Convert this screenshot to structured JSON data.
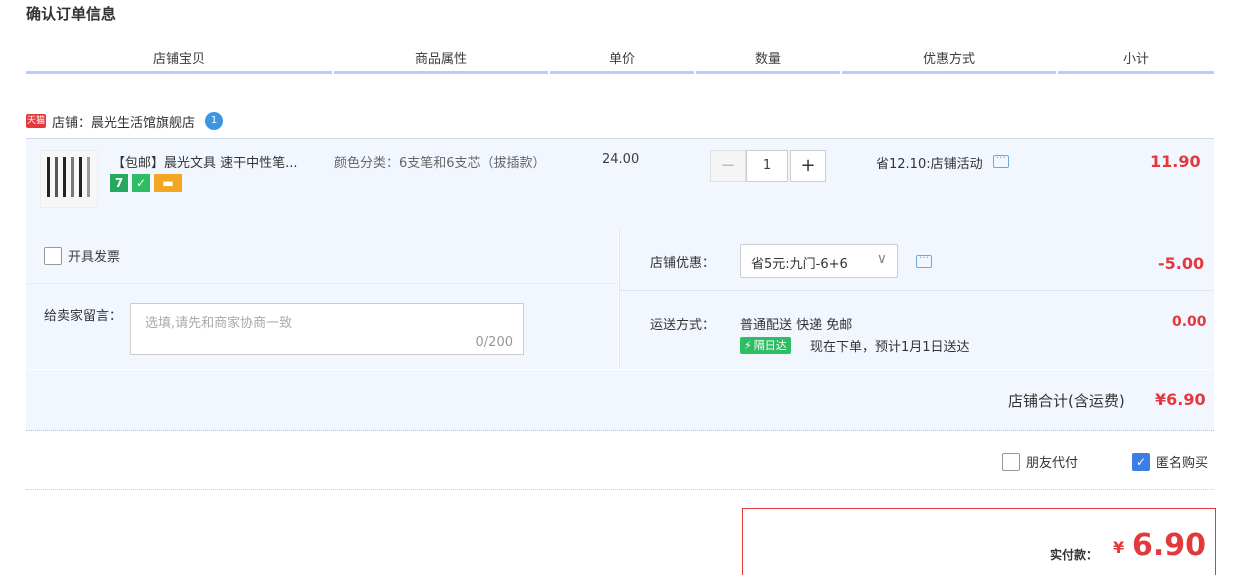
{
  "page_title": "确认订单信息",
  "columns": [
    "店铺宝贝",
    "商品属性",
    "单价",
    "数量",
    "优惠方式",
    "小计"
  ],
  "shop": {
    "badge": "天猫",
    "label": "店铺：晨光生活馆旗舰店",
    "ww_icon": "1"
  },
  "item": {
    "name": "【包邮】晨光文具 速干中性笔...",
    "badges": [
      "7",
      "✓",
      "▬"
    ],
    "attribute": "颜色分类：6支笔和6支芯（拔插款）",
    "unit_price": "24.00",
    "qty_minus": "−",
    "quantity": "1",
    "qty_plus": "+",
    "promo": "省12.10:店铺活动",
    "subtotal": "11.90"
  },
  "invoice": {
    "label": "开具发票"
  },
  "message": {
    "label": "给卖家留言：",
    "placeholder": "选填,请先和商家协商一致",
    "counter": "0/200"
  },
  "store_promo": {
    "label": "店铺优惠：",
    "selected": "省5元:九门-6+6",
    "amount": "-5.00"
  },
  "shipping": {
    "label": "运送方式：",
    "value": "普通配送 快递 免邮",
    "badge": "隔日达",
    "eta": "现在下单，预计1月1日送达",
    "amount": "0.00"
  },
  "store_total": {
    "label": "店铺合计(含运费)",
    "amount": "¥6.90"
  },
  "options": {
    "friend_pay": "朋友代付",
    "anonymous": "匿名购买",
    "anonymous_checked": true
  },
  "payment": {
    "label": "实付款：",
    "yen": "¥",
    "amount": "6.90"
  },
  "colors": {
    "accent_red": "#e4393c",
    "column_bar": "#b2d1ff",
    "panel_bg": "#f2f7ff"
  }
}
